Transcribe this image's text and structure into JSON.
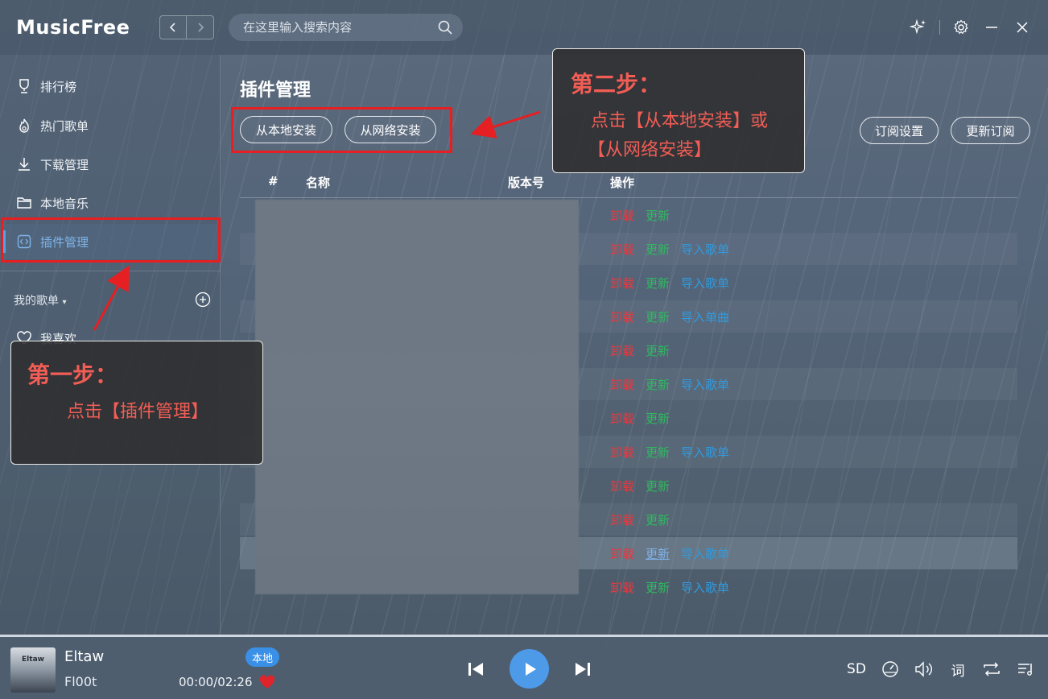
{
  "app": {
    "logo": "MusicFree",
    "search_placeholder": "在这里输入搜索内容"
  },
  "sidebar": {
    "items": [
      {
        "label": "排行榜",
        "icon": "trophy-icon"
      },
      {
        "label": "热门歌单",
        "icon": "fire-icon"
      },
      {
        "label": "下载管理",
        "icon": "download-icon"
      },
      {
        "label": "本地音乐",
        "icon": "folder-icon"
      },
      {
        "label": "插件管理",
        "icon": "code-icon",
        "active": true
      }
    ],
    "my_playlists_label": "我的歌单",
    "favorites_label": "我喜欢"
  },
  "main": {
    "title": "插件管理",
    "buttons": {
      "install_local": "从本地安装",
      "install_network": "从网络安装",
      "subscription_settings": "订阅设置",
      "update_subscription": "更新订阅"
    },
    "columns": [
      "#",
      "名称",
      "版本号",
      "操作"
    ],
    "rows": [
      {
        "ops": [
          "卸载",
          "更新"
        ]
      },
      {
        "ops": [
          "卸载",
          "更新",
          "导入歌单"
        ]
      },
      {
        "ops": [
          "卸载",
          "更新",
          "导入歌单"
        ]
      },
      {
        "ops": [
          "卸载",
          "更新",
          "导入单曲"
        ]
      },
      {
        "ops": [
          "卸载",
          "更新"
        ]
      },
      {
        "ops": [
          "卸载",
          "更新",
          "导入歌单"
        ]
      },
      {
        "ops": [
          "卸载",
          "更新"
        ]
      },
      {
        "ops": [
          "卸载",
          "更新",
          "导入歌单"
        ]
      },
      {
        "ops": [
          "卸载",
          "更新"
        ]
      },
      {
        "ops": [
          "卸载",
          "更新"
        ]
      },
      {
        "ops": [
          "卸载",
          "更新",
          "导入歌单"
        ]
      },
      {
        "ops": [
          "卸载",
          "更新",
          "导入歌单"
        ]
      }
    ]
  },
  "annotations": {
    "step1_title": "第一步：",
    "step1_desc": "点击【插件管理】",
    "step2_title": "第二步：",
    "step2_desc_line1": "点击【从本地安装】或",
    "step2_desc_line2": "【从网络安装】",
    "frame_color": "#e51f22",
    "text_color": "#f25d55"
  },
  "player": {
    "cover_text": "Eltaw",
    "title": "Eltaw",
    "artist": "Fl00t",
    "badge": "本地",
    "time": "00:00/02:26",
    "quality": "SD",
    "lyrics_label": "词",
    "progress": 0,
    "accent": "#3b8ee6"
  }
}
